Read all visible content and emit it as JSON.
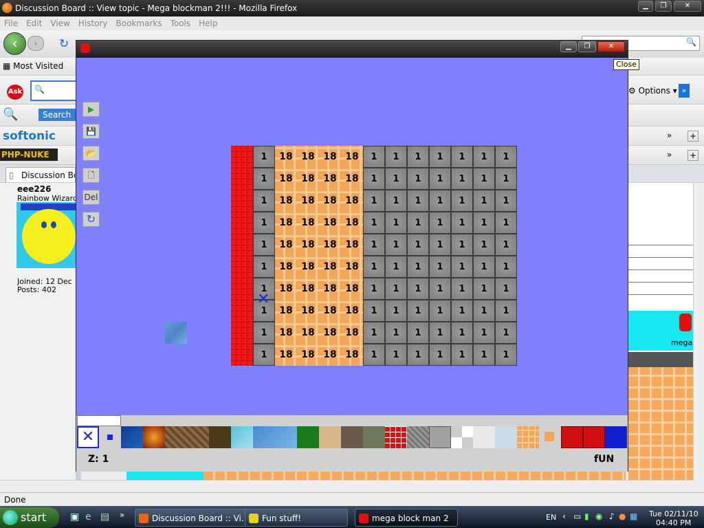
{
  "window": {
    "title": "Discussion Board :: View topic - Mega blockman 2!!! - Mozilla Firefox",
    "minimize": "▁",
    "maximize": "❐",
    "close": "✕"
  },
  "menu": [
    "File",
    "Edit",
    "View",
    "History",
    "Bookmarks",
    "Tools",
    "Help"
  ],
  "toolbar": {
    "most_visited": "Most Visited",
    "ask_logo": "Ask",
    "options": "Options",
    "search_btn": "Search",
    "softonic": "softonic",
    "phpnuke": "PHP-NUKE"
  },
  "tab": {
    "label": "Discussion Board"
  },
  "post": {
    "username": "eee226",
    "rank": "Rainbow Wizard",
    "joined": "Joined: 12 Dec",
    "posts": "Posts: 402"
  },
  "right_banner": {
    "text": "mega"
  },
  "status": "Done",
  "taskbar": {
    "start": "start",
    "tasks": [
      "Discussion Board :: Vi...",
      "Fun stuff!",
      "mega block man 2"
    ],
    "active_task": "mega block man 2",
    "language": "EN",
    "date": "Tue 02/11/10",
    "time": "04:40 PM"
  },
  "game": {
    "title": "",
    "tooltip": "Close",
    "tools": [
      {
        "icon": "play-icon",
        "label": "▶"
      },
      {
        "icon": "save-icon",
        "label": "💾"
      },
      {
        "icon": "open-folder-icon",
        "label": "📂"
      },
      {
        "icon": "new-file-icon",
        "label": "🗋"
      },
      {
        "icon": "delete-icon",
        "label": "Del"
      },
      {
        "icon": "rotate-icon",
        "label": "↻"
      }
    ],
    "grid": {
      "rows": 10,
      "red_column": true,
      "cell_labels": [
        "1",
        "18",
        "18",
        "18",
        "18",
        "1",
        "1",
        "1",
        "1",
        "1",
        "1",
        "1"
      ]
    },
    "palette_tiles": [
      "selected-x",
      "blue-small",
      "blue",
      "lava",
      "wood",
      "dirt",
      "water",
      "water-light",
      "grass",
      "sand",
      "crate",
      "moss",
      "red-brick",
      "metal",
      "stone",
      "checker",
      "snow",
      "ice",
      "orange-tile",
      "orange-small",
      "red-block",
      "red-block-2",
      "blue-block"
    ],
    "z_label": "Z: 1",
    "mode_label": "fUN"
  }
}
